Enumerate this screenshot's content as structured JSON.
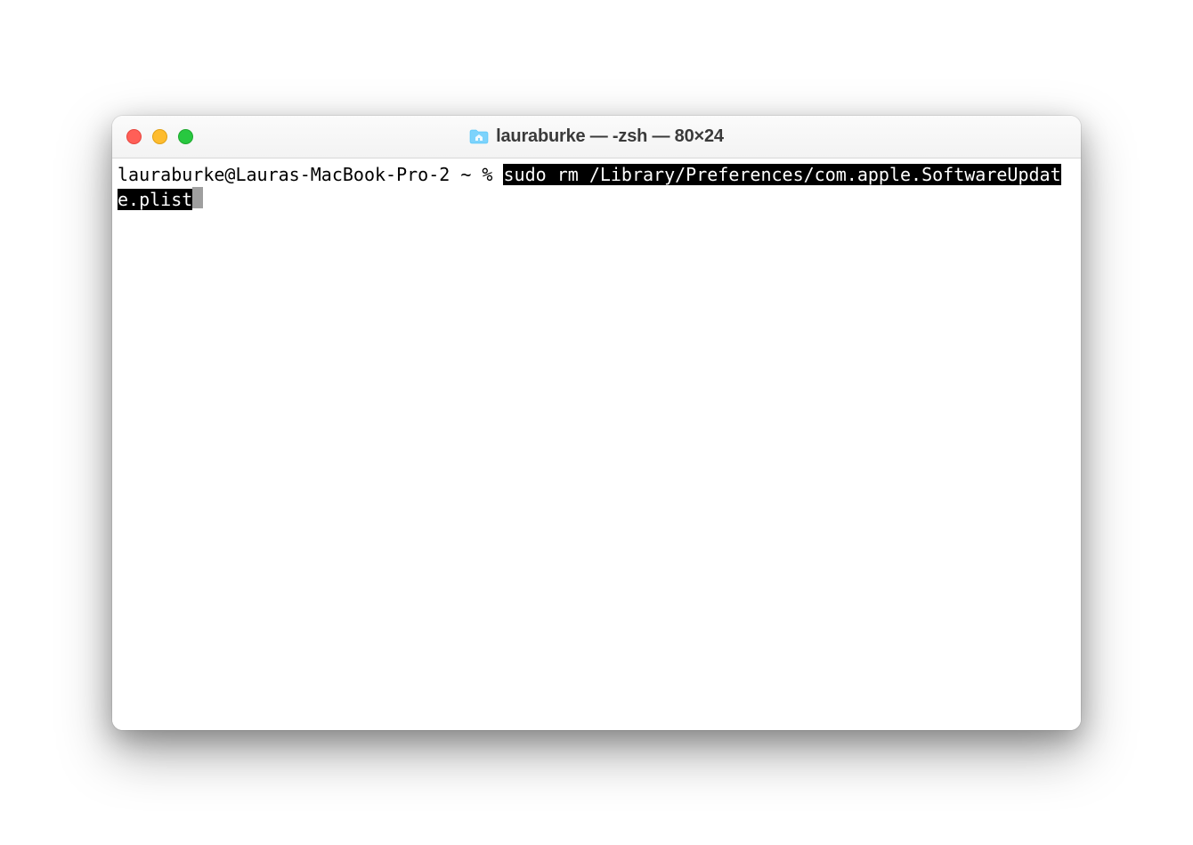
{
  "window": {
    "title": "lauraburke — -zsh — 80×24"
  },
  "terminal": {
    "prompt": "lauraburke@Lauras-MacBook-Pro-2 ~ % ",
    "command": "sudo rm /Library/Preferences/com.apple.SoftwareUpdate.plist"
  },
  "icons": {
    "folder": "home-folder-icon"
  },
  "colors": {
    "close": "#ff5f57",
    "minimize": "#febc2e",
    "zoom": "#28c840"
  }
}
